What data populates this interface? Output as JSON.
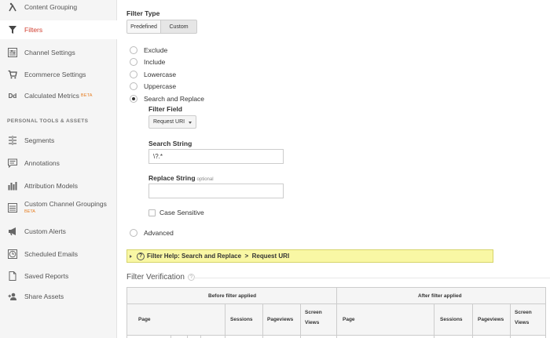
{
  "sidebar": {
    "items": [
      {
        "label": "Content Grouping",
        "icon": "content-grouping-icon",
        "active": false
      },
      {
        "label": "Filters",
        "icon": "filter-icon",
        "active": true
      },
      {
        "label": "Channel Settings",
        "icon": "channel-settings-icon",
        "active": false
      },
      {
        "label": "Ecommerce Settings",
        "icon": "cart-icon",
        "active": false
      },
      {
        "label": "Calculated Metrics",
        "icon": "dd-icon",
        "beta": "BETA",
        "active": false
      }
    ],
    "section_heading": "PERSONAL TOOLS & ASSETS",
    "tools": [
      {
        "label": "Segments",
        "icon": "segments-icon"
      },
      {
        "label": "Annotations",
        "icon": "annotations-icon"
      },
      {
        "label": "Attribution Models",
        "icon": "attribution-models-icon"
      },
      {
        "label": "Custom Channel Groupings",
        "icon": "custom-channel-groupings-icon",
        "beta": "BETA"
      },
      {
        "label": "Custom Alerts",
        "icon": "megaphone-icon"
      },
      {
        "label": "Scheduled Emails",
        "icon": "clock-icon"
      },
      {
        "label": "Saved Reports",
        "icon": "document-icon"
      },
      {
        "label": "Share Assets",
        "icon": "add-user-icon"
      }
    ],
    "dd_glyph": "Dd"
  },
  "filter_type": {
    "label": "Filter Type",
    "tabs": [
      "Predefined",
      "Custom"
    ],
    "selected_tab": "Custom"
  },
  "options": [
    {
      "label": "Exclude",
      "checked": false
    },
    {
      "label": "Include",
      "checked": false
    },
    {
      "label": "Lowercase",
      "checked": false
    },
    {
      "label": "Uppercase",
      "checked": false
    },
    {
      "label": "Search and Replace",
      "checked": true
    },
    {
      "label": "Advanced",
      "checked": false
    }
  ],
  "filter_field": {
    "label": "Filter Field",
    "value": "Request URI"
  },
  "search_string": {
    "label": "Search String",
    "value": "\\?.*"
  },
  "replace_string": {
    "label": "Replace String",
    "optional": "optional",
    "value": ""
  },
  "case_sensitive": {
    "label": "Case Sensitive",
    "checked": false
  },
  "help_bar": {
    "text": "Filter Help: Search and Replace  >  Request URI",
    "qmark": "?"
  },
  "verification": {
    "title": "Filter Verification",
    "qmark": "?",
    "before_label": "Before filter applied",
    "after_label": "After filter applied",
    "before_columns": [
      "Page",
      "Sessions",
      "Pageviews",
      "Screen Views"
    ],
    "after_columns": [
      "Page",
      "Sessions",
      "Pageviews",
      "Screen Views"
    ]
  },
  "colors": {
    "active": "#d23f31",
    "beta": "#e67e22",
    "help_bg": "#f9f7a4"
  }
}
